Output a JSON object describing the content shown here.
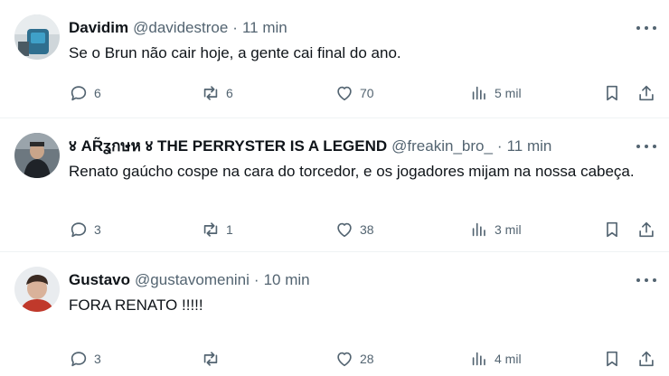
{
  "tweets": [
    {
      "name": "Davidim",
      "handle": "@davidestroe",
      "sep": "·",
      "time": "11 min",
      "text": "Se o Brun não cair hoje, a gente cai final do ano.",
      "replies": "6",
      "retweets": "6",
      "likes": "70",
      "views": "5 mil"
    },
    {
      "name": "४ AR̃ʓกษห ४ THE PERRYSTER IS A LEGEND",
      "handle": "@freakin_bro_",
      "sep": "·",
      "time": "11 min",
      "text": "Renato gaúcho cospe na cara do torcedor, e os jogadores mijam na nossa cabeça.",
      "replies": "3",
      "retweets": "1",
      "likes": "38",
      "views": "3 mil"
    },
    {
      "name": "Gustavo",
      "handle": "@gustavomenini",
      "sep": "·",
      "time": "10 min",
      "text": "FORA RENATO !!!!!",
      "replies": "3",
      "retweets": "",
      "likes": "28",
      "views": "4 mil"
    }
  ],
  "icons": {
    "reply": "reply-icon",
    "retweet": "retweet-icon",
    "like": "heart-icon",
    "views": "views-icon",
    "bookmark": "bookmark-icon",
    "share": "share-icon",
    "more": "more-icon"
  },
  "colors": {
    "text": "#0f1419",
    "muted": "#536471",
    "divider": "#eff3f4"
  }
}
